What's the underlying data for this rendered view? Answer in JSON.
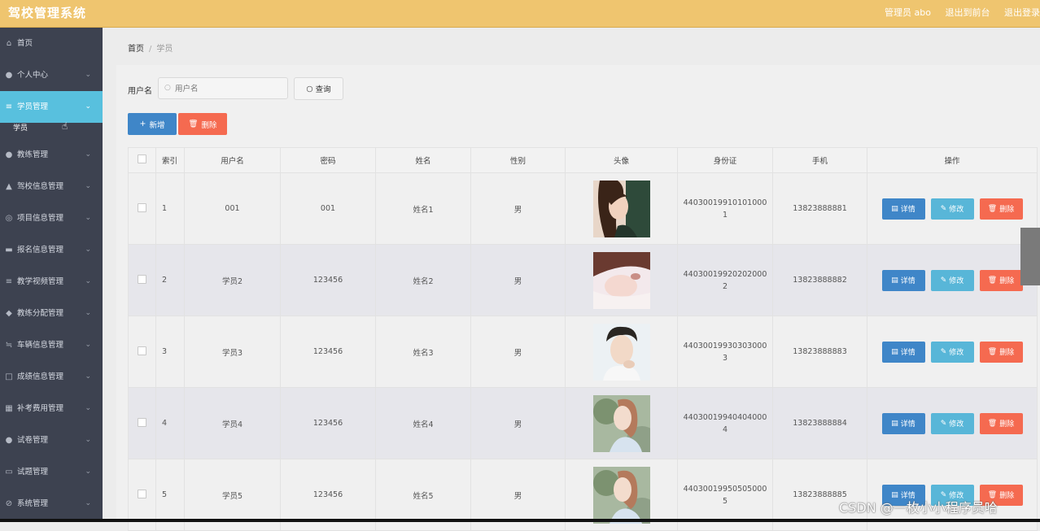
{
  "header": {
    "title": "驾校管理系统",
    "admin": "管理员 abo",
    "to_front": "退出到前台",
    "logout": "退出登录"
  },
  "sidebar": {
    "items": [
      {
        "label": "首页",
        "icon": "home-icon",
        "glyph": "⌂"
      },
      {
        "label": "个人中心",
        "icon": "user-icon",
        "glyph": "●"
      },
      {
        "label": "学员管理",
        "icon": "list-icon",
        "glyph": "≡",
        "active": true
      },
      {
        "label": "教练管理",
        "icon": "user-icon",
        "glyph": "●"
      },
      {
        "label": "驾校信息管理",
        "icon": "car-icon",
        "glyph": "▲"
      },
      {
        "label": "项目信息管理",
        "icon": "globe-icon",
        "glyph": "◎"
      },
      {
        "label": "报名信息管理",
        "icon": "ticket-icon",
        "glyph": "▬"
      },
      {
        "label": "教学视频管理",
        "icon": "list-icon",
        "glyph": "≡"
      },
      {
        "label": "教练分配管理",
        "icon": "location-icon",
        "glyph": "◆"
      },
      {
        "label": "车辆信息管理",
        "icon": "sliders-icon",
        "glyph": "≒"
      },
      {
        "label": "成绩信息管理",
        "icon": "crop-icon",
        "glyph": "□"
      },
      {
        "label": "补考费用管理",
        "icon": "grid-icon",
        "glyph": "▦"
      },
      {
        "label": "试卷管理",
        "icon": "user-icon",
        "glyph": "●"
      },
      {
        "label": "试题管理",
        "icon": "document-icon",
        "glyph": "▭"
      },
      {
        "label": "系统管理",
        "icon": "settings-icon",
        "glyph": "⊘"
      }
    ],
    "sub_label": "学员"
  },
  "breadcrumb": {
    "home": "首页",
    "separator": "/",
    "current": "学员"
  },
  "search": {
    "label": "用户名",
    "placeholder": "用户名",
    "button": "查询"
  },
  "toolbar": {
    "add": "新增",
    "delete": "删除"
  },
  "table": {
    "columns": [
      "索引",
      "用户名",
      "密码",
      "姓名",
      "性别",
      "头像",
      "身份证",
      "手机",
      "操作"
    ],
    "rows": [
      {
        "index": "1",
        "username": "001",
        "password": "001",
        "name": "姓名1",
        "gender": "男",
        "idcard": "440300199101010001",
        "phone": "13823888881",
        "avatar": "a"
      },
      {
        "index": "2",
        "username": "学员2",
        "password": "123456",
        "name": "姓名2",
        "gender": "男",
        "idcard": "440300199202020002",
        "phone": "13823888882",
        "avatar": "b"
      },
      {
        "index": "3",
        "username": "学员3",
        "password": "123456",
        "name": "姓名3",
        "gender": "男",
        "idcard": "440300199303030003",
        "phone": "13823888883",
        "avatar": "c"
      },
      {
        "index": "4",
        "username": "学员4",
        "password": "123456",
        "name": "姓名4",
        "gender": "男",
        "idcard": "440300199404040004",
        "phone": "13823888884",
        "avatar": "d"
      },
      {
        "index": "5",
        "username": "学员5",
        "password": "123456",
        "name": "姓名5",
        "gender": "男",
        "idcard": "440300199505050005",
        "phone": "13823888885",
        "avatar": "d"
      }
    ],
    "actions": {
      "detail": "详情",
      "edit": "修改",
      "delete": "删除"
    }
  },
  "watermark": "CSDN @一枚小小程序员哈",
  "colors": {
    "header": "#efc56f",
    "sidebar": "#3d4250",
    "active": "#58c0de",
    "primary": "#3f86c8",
    "info": "#58b6d8",
    "danger": "#f56a50"
  }
}
